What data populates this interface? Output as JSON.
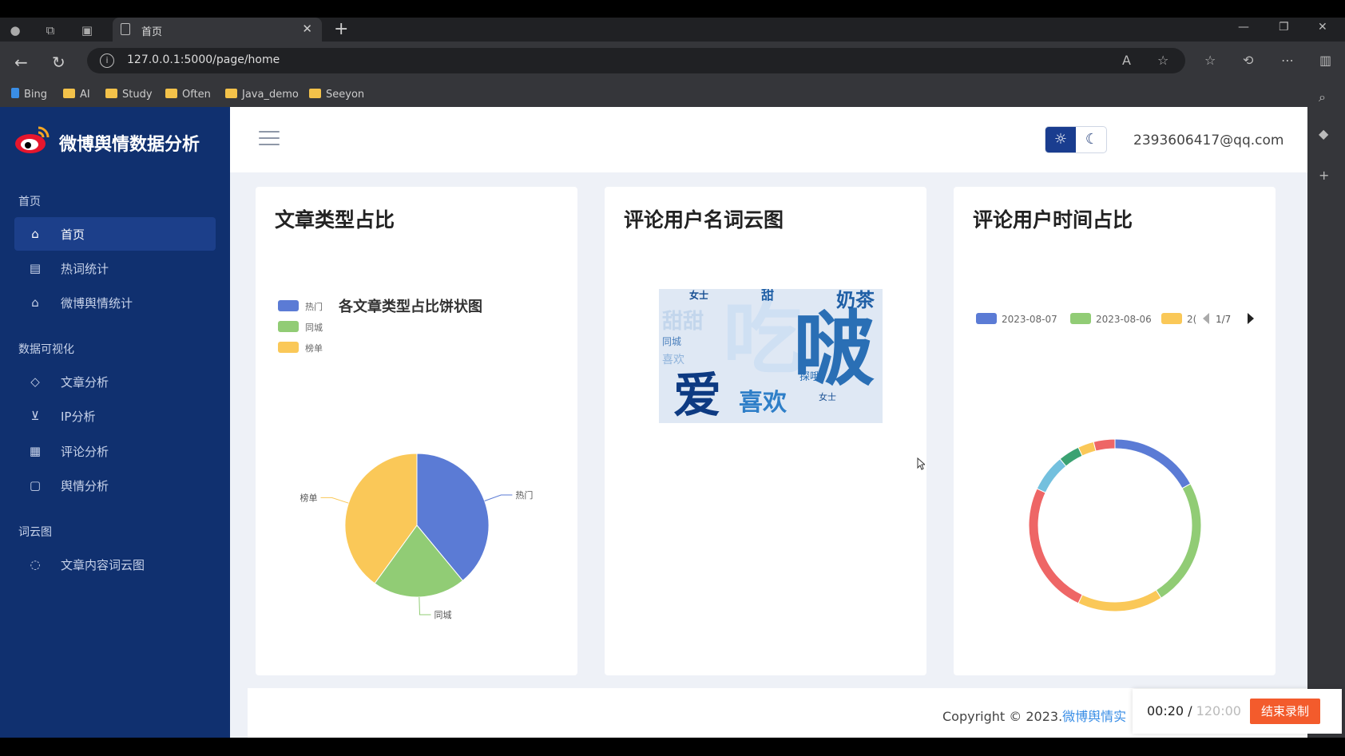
{
  "browser": {
    "tab_title": "首页",
    "url": "127.0.0.1:5000/page/home",
    "bookmarks": [
      "Bing",
      "AI",
      "Study",
      "Often",
      "Java_demo",
      "Seeyon"
    ]
  },
  "sidebar": {
    "brand": "微博舆情数据分析",
    "sections": [
      {
        "title": "首页",
        "items": [
          {
            "label": "首页",
            "icon": "home-icon",
            "active": true
          },
          {
            "label": "热词统计",
            "icon": "table-icon"
          },
          {
            "label": "微博舆情统计",
            "icon": "bank-icon"
          }
        ]
      },
      {
        "title": "数据可视化",
        "items": [
          {
            "label": "文章分析",
            "icon": "tag-icon"
          },
          {
            "label": "IP分析",
            "icon": "cart-icon"
          },
          {
            "label": "评论分析",
            "icon": "chart-doc-icon"
          },
          {
            "label": "舆情分析",
            "icon": "clipboard-icon"
          }
        ]
      },
      {
        "title": "词云图",
        "items": [
          {
            "label": "文章内容词云图",
            "icon": "chat-icon"
          }
        ]
      }
    ]
  },
  "header": {
    "user_email": "2393606417@qq.com",
    "theme_light_icon": "sun-icon",
    "theme_dark_icon": "moon-icon"
  },
  "cards": {
    "article_type": {
      "title": "文章类型占比",
      "chart_title": "各文章类型占比饼状图",
      "legend": [
        "热门",
        "同城",
        "榜单"
      ]
    },
    "wordcloud": {
      "title": "评论用户名词云图",
      "words": [
        "吃",
        "啵",
        "爱",
        "喜欢",
        "奶茶",
        "甜",
        "女士",
        "甜甜",
        "同城",
        "探哦",
        "女士",
        "喜欢"
      ]
    },
    "time_ratio": {
      "title": "评论用户时间占比",
      "legend": [
        "2023-08-07",
        "2023-08-06",
        "2("
      ],
      "pager": "1/7"
    }
  },
  "chart_data": [
    {
      "type": "pie",
      "title": "各文章类型占比饼状图",
      "series": [
        {
          "name": "",
          "values": [
            {
              "label": "热门",
              "value": 39,
              "color": "#5b7bd5"
            },
            {
              "label": "同城",
              "value": 21,
              "color": "#91cc75"
            },
            {
              "label": "榜单",
              "value": 40,
              "color": "#fac858"
            }
          ]
        }
      ]
    },
    {
      "type": "pie",
      "title": "",
      "donut": true,
      "series": [
        {
          "name": "",
          "values": [
            {
              "label": "2023-08-07",
              "value": 17,
              "color": "#5b7bd5"
            },
            {
              "label": "2023-08-06",
              "value": 24,
              "color": "#91cc75"
            },
            {
              "label": "",
              "value": 16,
              "color": "#fac858"
            },
            {
              "label": "",
              "value": 25,
              "color": "#ee6666"
            },
            {
              "label": "",
              "value": 7,
              "color": "#73c0de"
            },
            {
              "label": "",
              "value": 4,
              "color": "#3ba272"
            },
            {
              "label": "",
              "value": 3,
              "color": "#fac858"
            },
            {
              "label": "",
              "value": 4,
              "color": "#ee6666"
            }
          ]
        }
      ]
    }
  ],
  "footer": {
    "copyright": "Copyright © 2023.",
    "link": "微博舆情实"
  },
  "recorder": {
    "elapsed": "00:20",
    "separator": " / ",
    "total": "120:00",
    "stop_label": "结束录制"
  },
  "colors": {
    "sidebar_bg": "#10306f",
    "accent": "#1a3d8f",
    "stop_button": "#f35b2c"
  }
}
